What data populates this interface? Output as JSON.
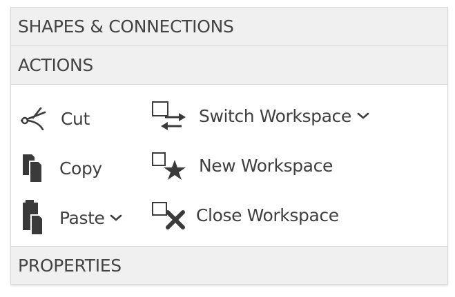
{
  "sections": {
    "shapes": {
      "label": "SHAPES & CONNECTIONS"
    },
    "actions": {
      "label": "ACTIONS"
    },
    "properties": {
      "label": "PROPERTIES"
    }
  },
  "actions": {
    "cut": {
      "label": "Cut",
      "icon": "scissors-icon"
    },
    "copy": {
      "label": "Copy",
      "icon": "copy-icon"
    },
    "paste": {
      "label": "Paste",
      "icon": "clipboard-icon"
    },
    "switch_workspace": {
      "label": "Switch Workspace",
      "icon": "switch-workspace-icon"
    },
    "new_workspace": {
      "label": "New Workspace",
      "icon": "new-workspace-icon"
    },
    "close_workspace": {
      "label": "Close Workspace",
      "icon": "close-workspace-icon"
    }
  },
  "colors": {
    "header_bg": "#f0f0f0",
    "text": "#3f3f3f",
    "icon": "#3a3a3a"
  }
}
